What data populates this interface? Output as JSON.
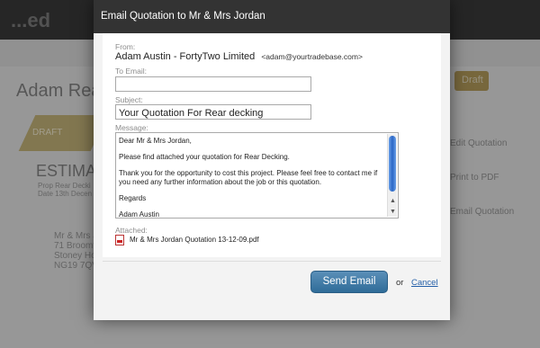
{
  "background": {
    "logo": "...ed",
    "heading": "Adam Rear D",
    "draft_button": "Draft",
    "draft_banner": "DRAFT",
    "estimate_title": "ESTIMATE",
    "estimate_line1": "Prop  Rear Decki",
    "estimate_line2": "Date  13th Decen",
    "address_lines": [
      "Mr & Mrs J",
      "71 Broomfi",
      "Stoney Hol",
      "NG19 7QV"
    ],
    "side_links": [
      "Edit Quotation",
      "Print to PDF",
      "Email Quotation"
    ]
  },
  "modal": {
    "title": "Email Quotation to Mr & Mrs Jordan",
    "from_label": "From:",
    "from_name": "Adam Austin - FortyTwo Limited",
    "from_email": "<adam@yourtradebase.com>",
    "to_label": "To Email:",
    "to_value": "",
    "subject_label": "Subject:",
    "subject_value": "Your Quotation For Rear decking",
    "message_label": "Message:",
    "message_lines": [
      "Dear Mr & Mrs Jordan,",
      "Please find attached your quotation for Rear Decking.",
      "Thank you for the opportunity to cost this project. Please feel free to contact me if you need any further information about the job or this quotation.",
      "Regards",
      "Adam Austin"
    ],
    "attached_label": "Attached:",
    "attachment_name": "Mr & Mrs Jordan Quotation 13-12-09.pdf",
    "send_label": "Send Email",
    "or_text": "or",
    "cancel_label": "Cancel"
  },
  "colors": {
    "header_bg": "#333333",
    "send_button": "#3a77a6",
    "link": "#245fa8"
  }
}
